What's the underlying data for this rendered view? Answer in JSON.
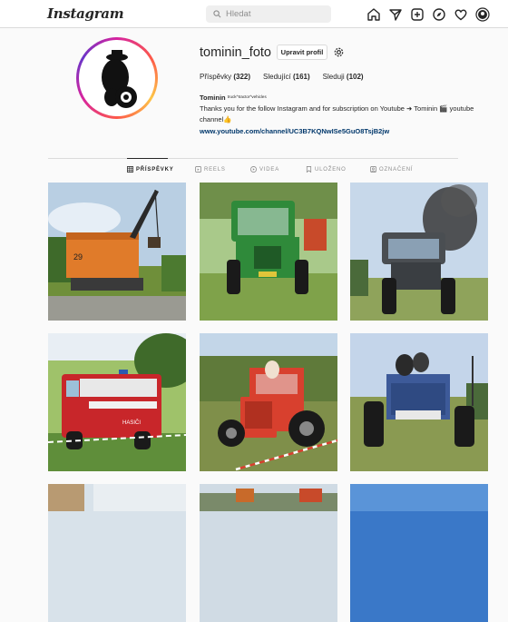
{
  "topbar": {
    "logo": "Instagram",
    "search_placeholder": "Hledat",
    "nav_icons": [
      "home-icon",
      "send-icon",
      "create-icon",
      "explore-icon",
      "heart-icon",
      "profile-icon"
    ]
  },
  "profile": {
    "username": "tominin_foto",
    "edit_label": "Upravit profil",
    "stats": {
      "posts_label": "Příspěvky",
      "posts_count": "(322)",
      "followers_label": "Sledující",
      "followers_count": "(161)",
      "following_label": "Sleduji",
      "following_count": "(102)"
    },
    "bio_name": "Tominin",
    "bio_tag": "truck^tractor^vehicles",
    "bio_text": "Thanks you for the follow Instagram and for subscription on Youtube ➜ Tominin 🎬 youtube channel👍",
    "bio_link": "www.youtube.com/channel/UC3B7KQNwISe5GuO8TsjB2jw"
  },
  "tabs": [
    {
      "label": "PŘÍSPĚVKY",
      "icon": "grid-icon",
      "active": true
    },
    {
      "label": "REELS",
      "icon": "reels-icon",
      "active": false
    },
    {
      "label": "VIDEA",
      "icon": "video-icon",
      "active": false
    },
    {
      "label": "ULOŽENO",
      "icon": "bookmark-icon",
      "active": false
    },
    {
      "label": "OZNAČENÍ",
      "icon": "tagged-icon",
      "active": false
    }
  ],
  "posts": [
    {
      "subject": "orange-excavator-crane",
      "sky": "#b9cfe3",
      "ground": "#6f8f3a",
      "vehicle": "#e07b2a"
    },
    {
      "subject": "green-tractor",
      "sky": "#a9c98a",
      "ground": "#7fa24a",
      "vehicle": "#2f8a3a"
    },
    {
      "subject": "grey-tractor-smoke",
      "sky": "#c7d8ea",
      "ground": "#8fa35b",
      "vehicle": "#4a4e52"
    },
    {
      "subject": "red-fire-truck",
      "sky": "#9fc26a",
      "ground": "#5f8e3a",
      "vehicle": "#c8262a"
    },
    {
      "subject": "red-tractor",
      "sky": "#c3d6e8",
      "ground": "#7f8f4a",
      "vehicle": "#d8402e"
    },
    {
      "subject": "blue-tractor",
      "sky": "#c4d5ea",
      "ground": "#8a9a52",
      "vehicle": "#3d5a99"
    }
  ]
}
